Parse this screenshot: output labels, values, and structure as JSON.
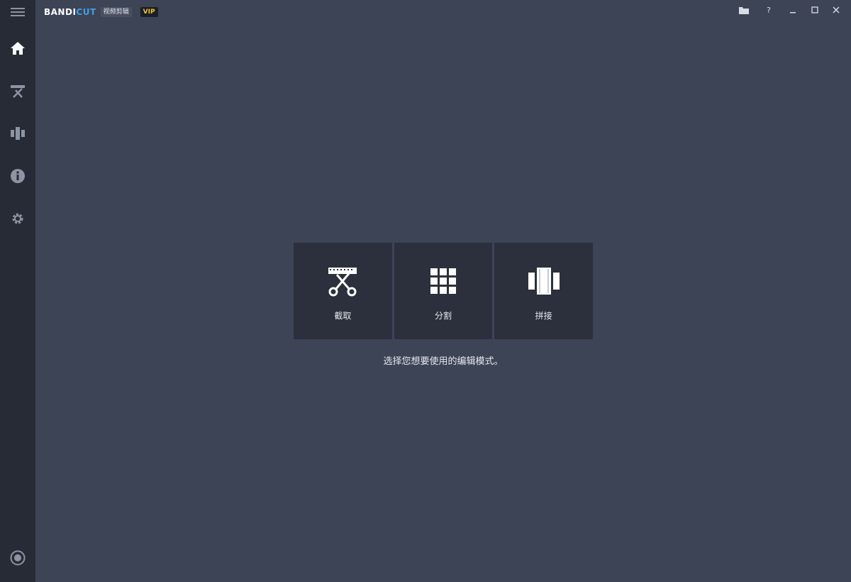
{
  "app": {
    "logo_bandi": "BANDI",
    "logo_cut": "CUT",
    "logo_sub": "视频剪辑",
    "vip_badge": "VIP"
  },
  "sidebar": {
    "items": [
      {
        "icon": "menu-icon"
      },
      {
        "icon": "home-icon"
      },
      {
        "icon": "cut-icon"
      },
      {
        "icon": "join-icon"
      },
      {
        "icon": "info-icon"
      },
      {
        "icon": "settings-icon"
      },
      {
        "icon": "record-icon"
      }
    ]
  },
  "window": {
    "help_label": "?"
  },
  "modes": [
    {
      "label": "截取",
      "icon": "scissors-icon"
    },
    {
      "label": "分割",
      "icon": "grid-icon"
    },
    {
      "label": "拼接",
      "icon": "join-frames-icon"
    }
  ],
  "hint": "选择您想要使用的编辑模式。",
  "colors": {
    "background": "#3d4456",
    "sidebar": "#262b35",
    "card": "#2b303c",
    "accent": "#3ea0e6",
    "vip": "#f2c230"
  }
}
